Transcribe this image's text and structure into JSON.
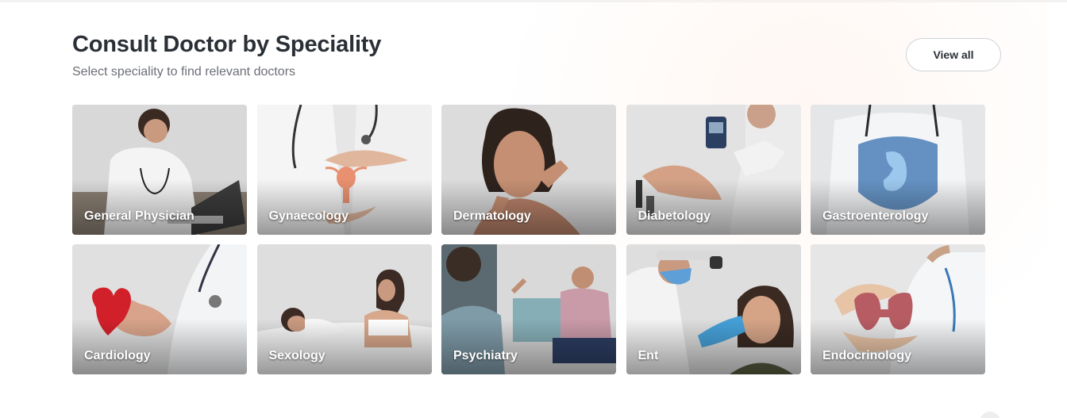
{
  "section": {
    "title": "Consult Doctor by Speciality",
    "subtitle": "Select speciality to find relevant doctors",
    "view_all_label": "View all"
  },
  "specialities": [
    {
      "label": "General Physician",
      "icon": "doctor-at-laptop"
    },
    {
      "label": "Gynaecology",
      "icon": "uterus-hologram"
    },
    {
      "label": "Dermatology",
      "icon": "woman-touching-face"
    },
    {
      "label": "Diabetology",
      "icon": "glucose-meter"
    },
    {
      "label": "Gastroenterology",
      "icon": "stomach-shield"
    },
    {
      "label": "Cardiology",
      "icon": "heart-in-hand"
    },
    {
      "label": "Sexology",
      "icon": "couple-in-bed"
    },
    {
      "label": "Psychiatry",
      "icon": "therapy-session"
    },
    {
      "label": "Ent",
      "icon": "ear-examination"
    },
    {
      "label": "Endocrinology",
      "icon": "thyroid-gland"
    }
  ],
  "colors": {
    "title": "#2b2f36",
    "subtitle": "#6b6f75",
    "button_border": "#cfd3d7",
    "label": "#ffffff"
  }
}
